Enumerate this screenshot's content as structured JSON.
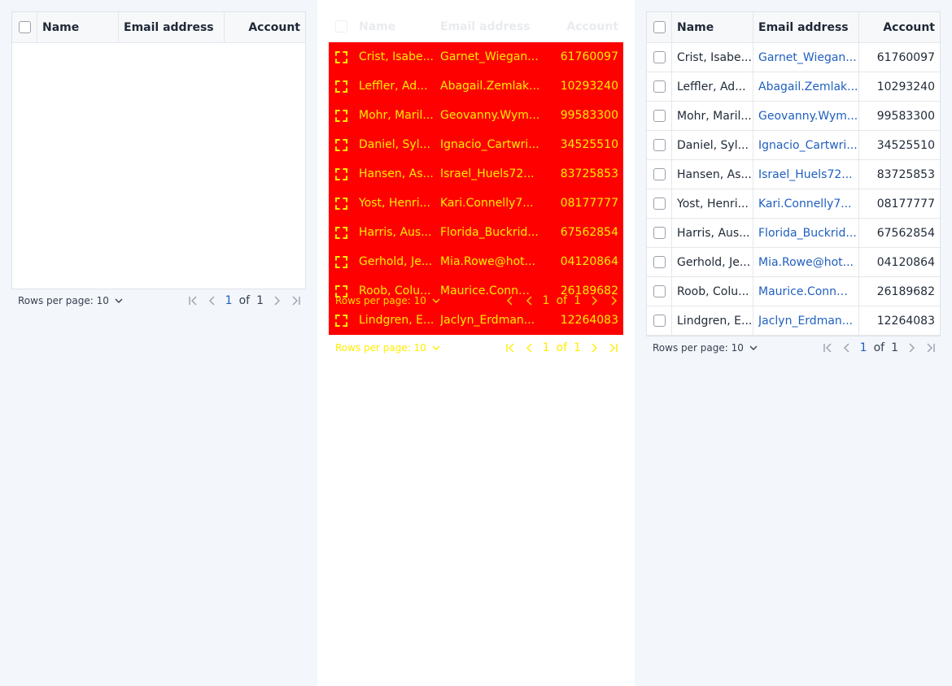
{
  "columns": {
    "name": "Name",
    "email": "Email address",
    "account": "Account"
  },
  "rows": [
    {
      "name": "Crist, Isabe...",
      "name_short": "Crist, Isabe...",
      "email": "Garnet_Wiegan...",
      "account": "61760097"
    },
    {
      "name": "Leffler, Ad...",
      "email": "Abagail.Zemlak...",
      "account": "10293240"
    },
    {
      "name": "Mohr, Maril...",
      "email": "Geovanny.Wym...",
      "account": "99583300"
    },
    {
      "name": "Daniel, Syl...",
      "email": "Ignacio_Cartwri...",
      "account": "34525510"
    },
    {
      "name": "Hansen, As...",
      "email": "Israel_Huels72...",
      "account": "83725853"
    },
    {
      "name": "Yost, Henri...",
      "email": "Kari.Connelly7...",
      "account": "08177777"
    },
    {
      "name": "Harris, Aus...",
      "email": "Florida_Buckrid...",
      "account": "67562854"
    },
    {
      "name": "Gerhold, Je...",
      "email": "Mia.Rowe@hot...",
      "account": "04120864"
    },
    {
      "name": "Roob, Colu...",
      "email": "Maurice.Conn@...",
      "account": "26189682"
    },
    {
      "name": "Lindgren, E...",
      "email": "Jaclyn_Erdman...",
      "account": "12264083"
    }
  ],
  "footer": {
    "rows_per_page": "Rows per page: 10",
    "page": "1",
    "of": "of",
    "total": "1"
  },
  "colors": {
    "overlay": "#ff0000",
    "overlay_text": "#ffee00",
    "link": "#1f5fbf"
  }
}
